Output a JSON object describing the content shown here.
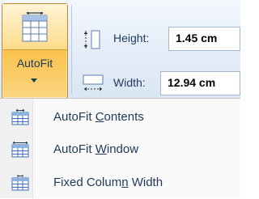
{
  "ribbon": {
    "autofit": {
      "label": "AutoFit",
      "icon": "table-autofit-icon"
    },
    "height": {
      "label": "Height:",
      "value": "1.45 cm",
      "icon": "row-height-icon"
    },
    "width": {
      "label": "Width:",
      "value": "12.94 cm",
      "icon": "column-width-icon"
    }
  },
  "menu": {
    "items": [
      {
        "pre": "AutoFit ",
        "key": "C",
        "post": "ontents",
        "icon": "autofit-contents-icon"
      },
      {
        "pre": "AutoFit ",
        "key": "W",
        "post": "indow",
        "icon": "autofit-window-icon"
      },
      {
        "pre": "Fixed Colum",
        "key": "n",
        "post": " Width",
        "icon": "fixed-column-width-icon"
      }
    ]
  },
  "colors": {
    "pressed_top": "#fde9b9",
    "pressed_bottom": "#f8be45",
    "text": "#1e395b",
    "icon_blue": "#3a6fb7"
  }
}
